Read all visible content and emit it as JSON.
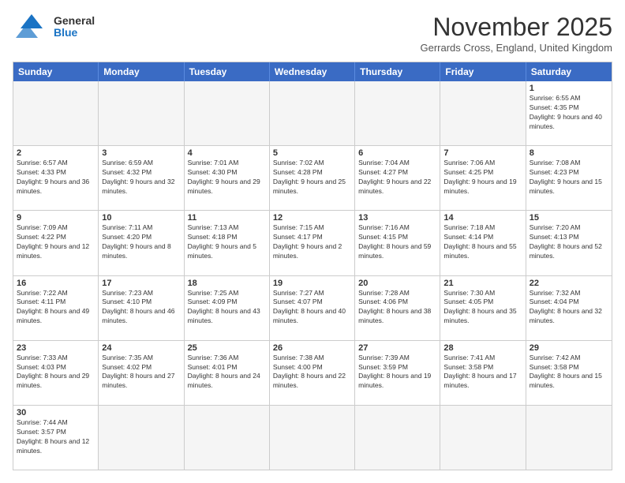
{
  "logo": {
    "text_general": "General",
    "text_blue": "Blue"
  },
  "header": {
    "month": "November 2025",
    "location": "Gerrards Cross, England, United Kingdom"
  },
  "days_of_week": [
    "Sunday",
    "Monday",
    "Tuesday",
    "Wednesday",
    "Thursday",
    "Friday",
    "Saturday"
  ],
  "weeks": [
    [
      {
        "day": "",
        "empty": true
      },
      {
        "day": "",
        "empty": true
      },
      {
        "day": "",
        "empty": true
      },
      {
        "day": "",
        "empty": true
      },
      {
        "day": "",
        "empty": true
      },
      {
        "day": "",
        "empty": true
      },
      {
        "day": "1",
        "info": "Sunrise: 6:55 AM\nSunset: 4:35 PM\nDaylight: 9 hours and 40 minutes."
      }
    ],
    [
      {
        "day": "2",
        "info": "Sunrise: 6:57 AM\nSunset: 4:33 PM\nDaylight: 9 hours and 36 minutes."
      },
      {
        "day": "3",
        "info": "Sunrise: 6:59 AM\nSunset: 4:32 PM\nDaylight: 9 hours and 32 minutes."
      },
      {
        "day": "4",
        "info": "Sunrise: 7:01 AM\nSunset: 4:30 PM\nDaylight: 9 hours and 29 minutes."
      },
      {
        "day": "5",
        "info": "Sunrise: 7:02 AM\nSunset: 4:28 PM\nDaylight: 9 hours and 25 minutes."
      },
      {
        "day": "6",
        "info": "Sunrise: 7:04 AM\nSunset: 4:27 PM\nDaylight: 9 hours and 22 minutes."
      },
      {
        "day": "7",
        "info": "Sunrise: 7:06 AM\nSunset: 4:25 PM\nDaylight: 9 hours and 19 minutes."
      },
      {
        "day": "8",
        "info": "Sunrise: 7:08 AM\nSunset: 4:23 PM\nDaylight: 9 hours and 15 minutes."
      }
    ],
    [
      {
        "day": "9",
        "info": "Sunrise: 7:09 AM\nSunset: 4:22 PM\nDaylight: 9 hours and 12 minutes."
      },
      {
        "day": "10",
        "info": "Sunrise: 7:11 AM\nSunset: 4:20 PM\nDaylight: 9 hours and 8 minutes."
      },
      {
        "day": "11",
        "info": "Sunrise: 7:13 AM\nSunset: 4:18 PM\nDaylight: 9 hours and 5 minutes."
      },
      {
        "day": "12",
        "info": "Sunrise: 7:15 AM\nSunset: 4:17 PM\nDaylight: 9 hours and 2 minutes."
      },
      {
        "day": "13",
        "info": "Sunrise: 7:16 AM\nSunset: 4:15 PM\nDaylight: 8 hours and 59 minutes."
      },
      {
        "day": "14",
        "info": "Sunrise: 7:18 AM\nSunset: 4:14 PM\nDaylight: 8 hours and 55 minutes."
      },
      {
        "day": "15",
        "info": "Sunrise: 7:20 AM\nSunset: 4:13 PM\nDaylight: 8 hours and 52 minutes."
      }
    ],
    [
      {
        "day": "16",
        "info": "Sunrise: 7:22 AM\nSunset: 4:11 PM\nDaylight: 8 hours and 49 minutes."
      },
      {
        "day": "17",
        "info": "Sunrise: 7:23 AM\nSunset: 4:10 PM\nDaylight: 8 hours and 46 minutes."
      },
      {
        "day": "18",
        "info": "Sunrise: 7:25 AM\nSunset: 4:09 PM\nDaylight: 8 hours and 43 minutes."
      },
      {
        "day": "19",
        "info": "Sunrise: 7:27 AM\nSunset: 4:07 PM\nDaylight: 8 hours and 40 minutes."
      },
      {
        "day": "20",
        "info": "Sunrise: 7:28 AM\nSunset: 4:06 PM\nDaylight: 8 hours and 38 minutes."
      },
      {
        "day": "21",
        "info": "Sunrise: 7:30 AM\nSunset: 4:05 PM\nDaylight: 8 hours and 35 minutes."
      },
      {
        "day": "22",
        "info": "Sunrise: 7:32 AM\nSunset: 4:04 PM\nDaylight: 8 hours and 32 minutes."
      }
    ],
    [
      {
        "day": "23",
        "info": "Sunrise: 7:33 AM\nSunset: 4:03 PM\nDaylight: 8 hours and 29 minutes."
      },
      {
        "day": "24",
        "info": "Sunrise: 7:35 AM\nSunset: 4:02 PM\nDaylight: 8 hours and 27 minutes."
      },
      {
        "day": "25",
        "info": "Sunrise: 7:36 AM\nSunset: 4:01 PM\nDaylight: 8 hours and 24 minutes."
      },
      {
        "day": "26",
        "info": "Sunrise: 7:38 AM\nSunset: 4:00 PM\nDaylight: 8 hours and 22 minutes."
      },
      {
        "day": "27",
        "info": "Sunrise: 7:39 AM\nSunset: 3:59 PM\nDaylight: 8 hours and 19 minutes."
      },
      {
        "day": "28",
        "info": "Sunrise: 7:41 AM\nSunset: 3:58 PM\nDaylight: 8 hours and 17 minutes."
      },
      {
        "day": "29",
        "info": "Sunrise: 7:42 AM\nSunset: 3:58 PM\nDaylight: 8 hours and 15 minutes."
      }
    ],
    [
      {
        "day": "30",
        "info": "Sunrise: 7:44 AM\nSunset: 3:57 PM\nDaylight: 8 hours and 12 minutes."
      },
      {
        "day": "",
        "empty": true
      },
      {
        "day": "",
        "empty": true
      },
      {
        "day": "",
        "empty": true
      },
      {
        "day": "",
        "empty": true
      },
      {
        "day": "",
        "empty": true
      },
      {
        "day": "",
        "empty": true
      }
    ]
  ]
}
